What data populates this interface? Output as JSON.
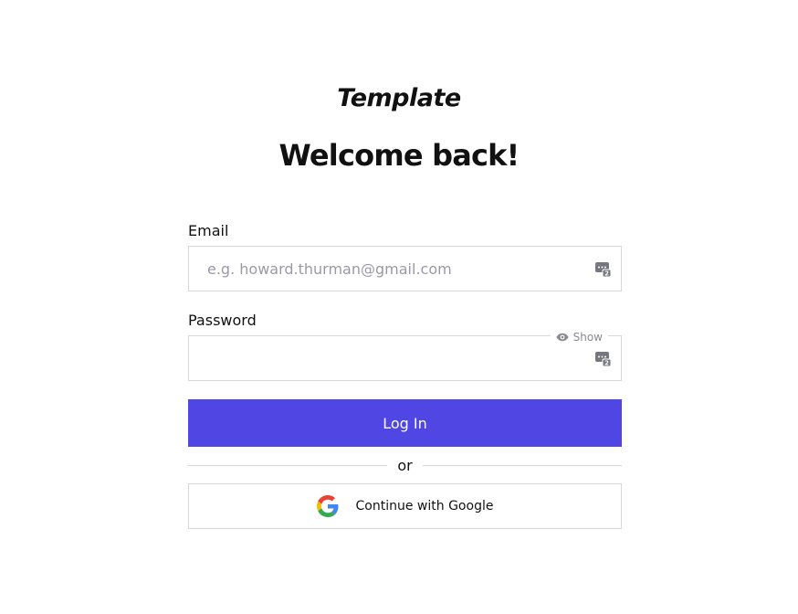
{
  "brand": {
    "logo_text": "Template"
  },
  "heading": "Welcome back!",
  "form": {
    "email": {
      "label": "Email",
      "placeholder": "e.g. howard.thurman@gmail.com",
      "value": ""
    },
    "password": {
      "label": "Password",
      "value": "",
      "show_label": "Show"
    },
    "login_label": "Log In",
    "divider_text": "or",
    "google_label": "Continue with Google"
  },
  "icons": {
    "password_manager": "password-manager-icon",
    "eye": "eye-icon",
    "google": "google-logo-icon"
  },
  "colors": {
    "primary": "#5046e4",
    "border": "#d8d8dc",
    "placeholder": "#9a9aa6",
    "text": "#111111"
  }
}
